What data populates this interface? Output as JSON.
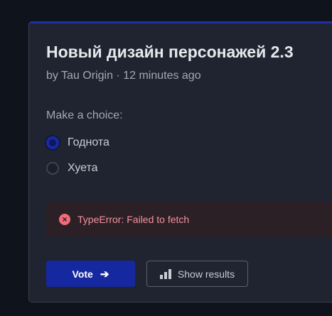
{
  "poll": {
    "title": "Новый дизайн персонажей 2.3",
    "meta": "by Tau Origin · 12 minutes ago",
    "prompt": "Make a choice:",
    "options": [
      {
        "label": "Годнота",
        "selected": true
      },
      {
        "label": "Хуета",
        "selected": false
      }
    ]
  },
  "error": {
    "message": "TypeError: Failed to fetch",
    "icon": "x-circle-icon",
    "color": "#f16b78"
  },
  "actions": {
    "vote_label": "Vote",
    "vote_icon": "arrow-right-icon",
    "results_label": "Show results",
    "results_icon": "bar-chart-icon"
  },
  "colors": {
    "accent": "#1628a0",
    "card_background": "#1f2430",
    "page_background": "#0f131b"
  }
}
